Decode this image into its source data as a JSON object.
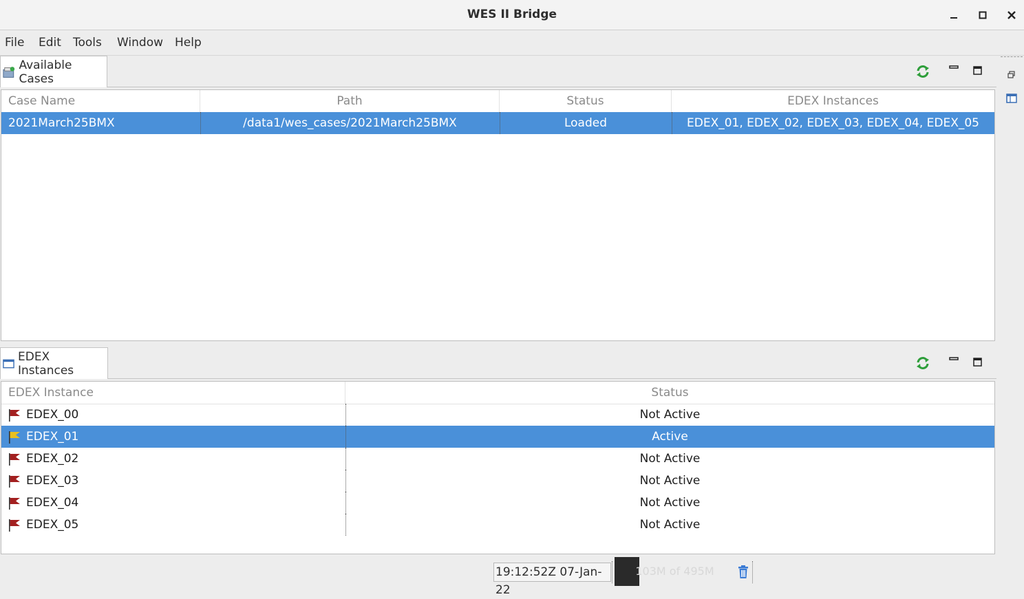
{
  "window": {
    "title": "WES II Bridge"
  },
  "menubar": {
    "items": [
      "File",
      "Edit",
      "Tools",
      "Window",
      "Help"
    ]
  },
  "cases_panel": {
    "tab_label": "Available Cases",
    "columns": [
      "Case Name",
      "Path",
      "Status",
      "EDEX Instances"
    ],
    "rows": [
      {
        "case_name": "2021March25BMX",
        "path": "/data1/wes_cases/2021March25BMX",
        "status": "Loaded",
        "edex_instances": "EDEX_01, EDEX_02, EDEX_03, EDEX_04, EDEX_05",
        "selected": true
      }
    ]
  },
  "edex_panel": {
    "tab_label": "EDEX Instances",
    "columns": [
      "EDEX Instance",
      "Status"
    ],
    "rows": [
      {
        "name": "EDEX_00",
        "status": "Not Active",
        "selected": false,
        "flag_color": "#a32020"
      },
      {
        "name": "EDEX_01",
        "status": "Active",
        "selected": true,
        "flag_color": "#e8c020"
      },
      {
        "name": "EDEX_02",
        "status": "Not Active",
        "selected": false,
        "flag_color": "#a32020"
      },
      {
        "name": "EDEX_03",
        "status": "Not Active",
        "selected": false,
        "flag_color": "#a32020"
      },
      {
        "name": "EDEX_04",
        "status": "Not Active",
        "selected": false,
        "flag_color": "#a32020"
      },
      {
        "name": "EDEX_05",
        "status": "Not Active",
        "selected": false,
        "flag_color": "#a32020"
      }
    ]
  },
  "statusbar": {
    "time": "19:12:52Z 07-Jan-22",
    "heap_label": "103M of 495M",
    "heap_used_fraction": 0.208
  },
  "colors": {
    "selection": "#4a90d9",
    "refresh_icon": "#2e9e3a",
    "trash_icon": "#3a7bd5"
  },
  "icons": [
    "cases-icon",
    "edex-panel-icon",
    "refresh-icon",
    "minimize-icon",
    "maximize-icon",
    "flag-icon",
    "trash-icon",
    "restore-icon",
    "view-icon"
  ]
}
